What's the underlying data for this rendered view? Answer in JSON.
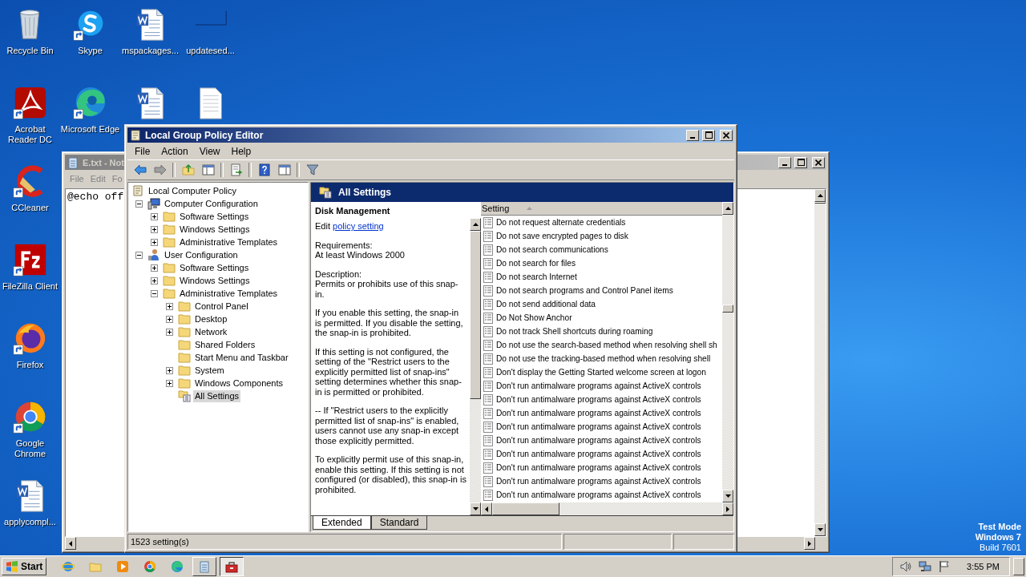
{
  "desktop": {
    "icon_columns": [
      [
        {
          "label": "Recycle Bin",
          "kind": "recycle",
          "shortcut": false
        },
        {
          "label": "Acrobat Reader DC",
          "kind": "acrobat",
          "shortcut": true
        },
        {
          "label": "CCleaner",
          "kind": "ccleaner",
          "shortcut": true
        },
        {
          "label": "FileZilla Client",
          "kind": "filezilla",
          "shortcut": true
        },
        {
          "label": "Firefox",
          "kind": "firefox",
          "shortcut": true
        },
        {
          "label": "Google Chrome",
          "kind": "chrome",
          "shortcut": true
        },
        {
          "label": "applycompl...",
          "kind": "word",
          "shortcut": false
        }
      ],
      [
        {
          "label": "Skype",
          "kind": "skype",
          "shortcut": true
        },
        {
          "label": "Microsoft Edge",
          "kind": "edge",
          "shortcut": true
        }
      ],
      [
        {
          "label": "mspackages...",
          "kind": "word",
          "shortcut": false
        },
        {
          "kind": "word",
          "shortcut": false
        }
      ],
      [
        {
          "label": "updatesed...",
          "kind": "blank",
          "shortcut": false
        },
        {
          "kind": "text",
          "shortcut": false
        }
      ]
    ],
    "system_info": {
      "mode": "Test Mode",
      "edition": "Windows 7",
      "build": "Build 7601"
    }
  },
  "notepad": {
    "title": "E.txt - Not",
    "menus": [
      "File",
      "Edit",
      "Fo"
    ],
    "content": "@echo off"
  },
  "editor": {
    "title": "Local Group Policy Editor",
    "menus": [
      "File",
      "Action",
      "View",
      "Help"
    ],
    "toolbar": [
      {
        "kind": "back"
      },
      {
        "kind": "forward"
      },
      {
        "kind": "separator"
      },
      {
        "kind": "up"
      },
      {
        "kind": "tree"
      },
      {
        "kind": "separator"
      },
      {
        "kind": "export"
      },
      {
        "kind": "separator"
      },
      {
        "kind": "help"
      },
      {
        "kind": "pane"
      },
      {
        "kind": "separator"
      },
      {
        "kind": "filter"
      }
    ],
    "tree": {
      "label": "Local Computer Policy",
      "kind": "policy",
      "selected": false,
      "children": [
        {
          "label": "Computer Configuration",
          "kind": "computer",
          "expanded": true,
          "selected": false,
          "children": [
            {
              "label": "Software Settings",
              "kind": "folder",
              "expanded": false,
              "selected": false
            },
            {
              "label": "Windows Settings",
              "kind": "folder",
              "expanded": false,
              "selected": false
            },
            {
              "label": "Administrative Templates",
              "kind": "folder",
              "expanded": false,
              "selected": false
            }
          ]
        },
        {
          "label": "User Configuration",
          "kind": "user",
          "expanded": true,
          "selected": false,
          "children": [
            {
              "label": "Software Settings",
              "kind": "folder",
              "expanded": false,
              "selected": false
            },
            {
              "label": "Windows Settings",
              "kind": "folder",
              "expanded": false,
              "selected": false
            },
            {
              "label": "Administrative Templates",
              "kind": "folder",
              "expanded": true,
              "selected": false,
              "children": [
                {
                  "label": "Control Panel",
                  "kind": "folder",
                  "expanded": false,
                  "selected": false
                },
                {
                  "label": "Desktop",
                  "kind": "folder",
                  "expanded": false,
                  "selected": false
                },
                {
                  "label": "Network",
                  "kind": "folder",
                  "expanded": false,
                  "selected": false
                },
                {
                  "label": "Shared Folders",
                  "kind": "folder",
                  "selected": false
                },
                {
                  "label": "Start Menu and Taskbar",
                  "kind": "folder",
                  "selected": false
                },
                {
                  "label": "System",
                  "kind": "folder",
                  "expanded": false,
                  "selected": false
                },
                {
                  "label": "Windows Components",
                  "kind": "folder",
                  "expanded": false,
                  "selected": false
                },
                {
                  "label": "All Settings",
                  "kind": "all",
                  "selected": true
                }
              ]
            }
          ]
        }
      ]
    },
    "pane_title": "All Settings",
    "details": {
      "title": "Disk Management",
      "edit_prefix": "Edit",
      "edit_link": "policy setting",
      "requirements_label": "Requirements:",
      "requirements": "At least Windows 2000",
      "description_label": "Description:",
      "paragraphs": [
        "Permits or prohibits use of this snap-in.",
        "If you enable this setting, the snap-in is permitted. If you disable the setting, the snap-in is prohibited.",
        "If this setting is not configured, the setting of the \"Restrict users to the explicitly permitted list of snap-ins\" setting determines whether this snap-in is permitted or prohibited.",
        "--  If \"Restrict users to the explicitly permitted list of snap-ins\" is enabled, users cannot use any snap-in except those explicitly permitted.",
        "To explicitly permit use of this snap-in, enable this setting. If this setting is not configured (or disabled), this snap-in is prohibited."
      ]
    },
    "settings_list": {
      "column": "Setting",
      "rows": [
        "Do not request alternate credentials",
        "Do not save encrypted pages to disk",
        "Do not search communications",
        "Do not search for files",
        "Do not search Internet",
        "Do not search programs and Control Panel items",
        "Do not send additional data",
        "Do Not Show Anchor",
        "Do not track Shell shortcuts during roaming",
        "Do not use the search-based method when resolving shell sh",
        "Do not use the tracking-based method when resolving shell",
        "Don't display the Getting Started welcome screen at logon",
        "Don't run antimalware programs against ActiveX controls",
        "Don't run antimalware programs against ActiveX controls",
        "Don't run antimalware programs against ActiveX controls",
        "Don't run antimalware programs against ActiveX controls",
        "Don't run antimalware programs against ActiveX controls",
        "Don't run antimalware programs against ActiveX controls",
        "Don't run antimalware programs against ActiveX controls",
        "Don't run antimalware programs against ActiveX controls",
        "Don't run antimalware programs against ActiveX controls"
      ]
    },
    "tabs": [
      {
        "label": "Extended",
        "selected": true
      },
      {
        "label": "Standard",
        "selected": false
      }
    ],
    "status_bar": "1523 setting(s)"
  },
  "taskbar": {
    "start": "Start",
    "quick_launch": [
      {
        "kind": "ie"
      },
      {
        "kind": "explorer"
      },
      {
        "kind": "media"
      },
      {
        "kind": "chrome"
      },
      {
        "kind": "edge"
      }
    ],
    "tasks": [
      {
        "kind": "notepad",
        "active": false
      },
      {
        "kind": "toolbox",
        "active": true
      }
    ],
    "tray": [
      {
        "kind": "speaker"
      },
      {
        "kind": "network"
      },
      {
        "kind": "flag"
      }
    ],
    "clock": "3:55 PM"
  }
}
